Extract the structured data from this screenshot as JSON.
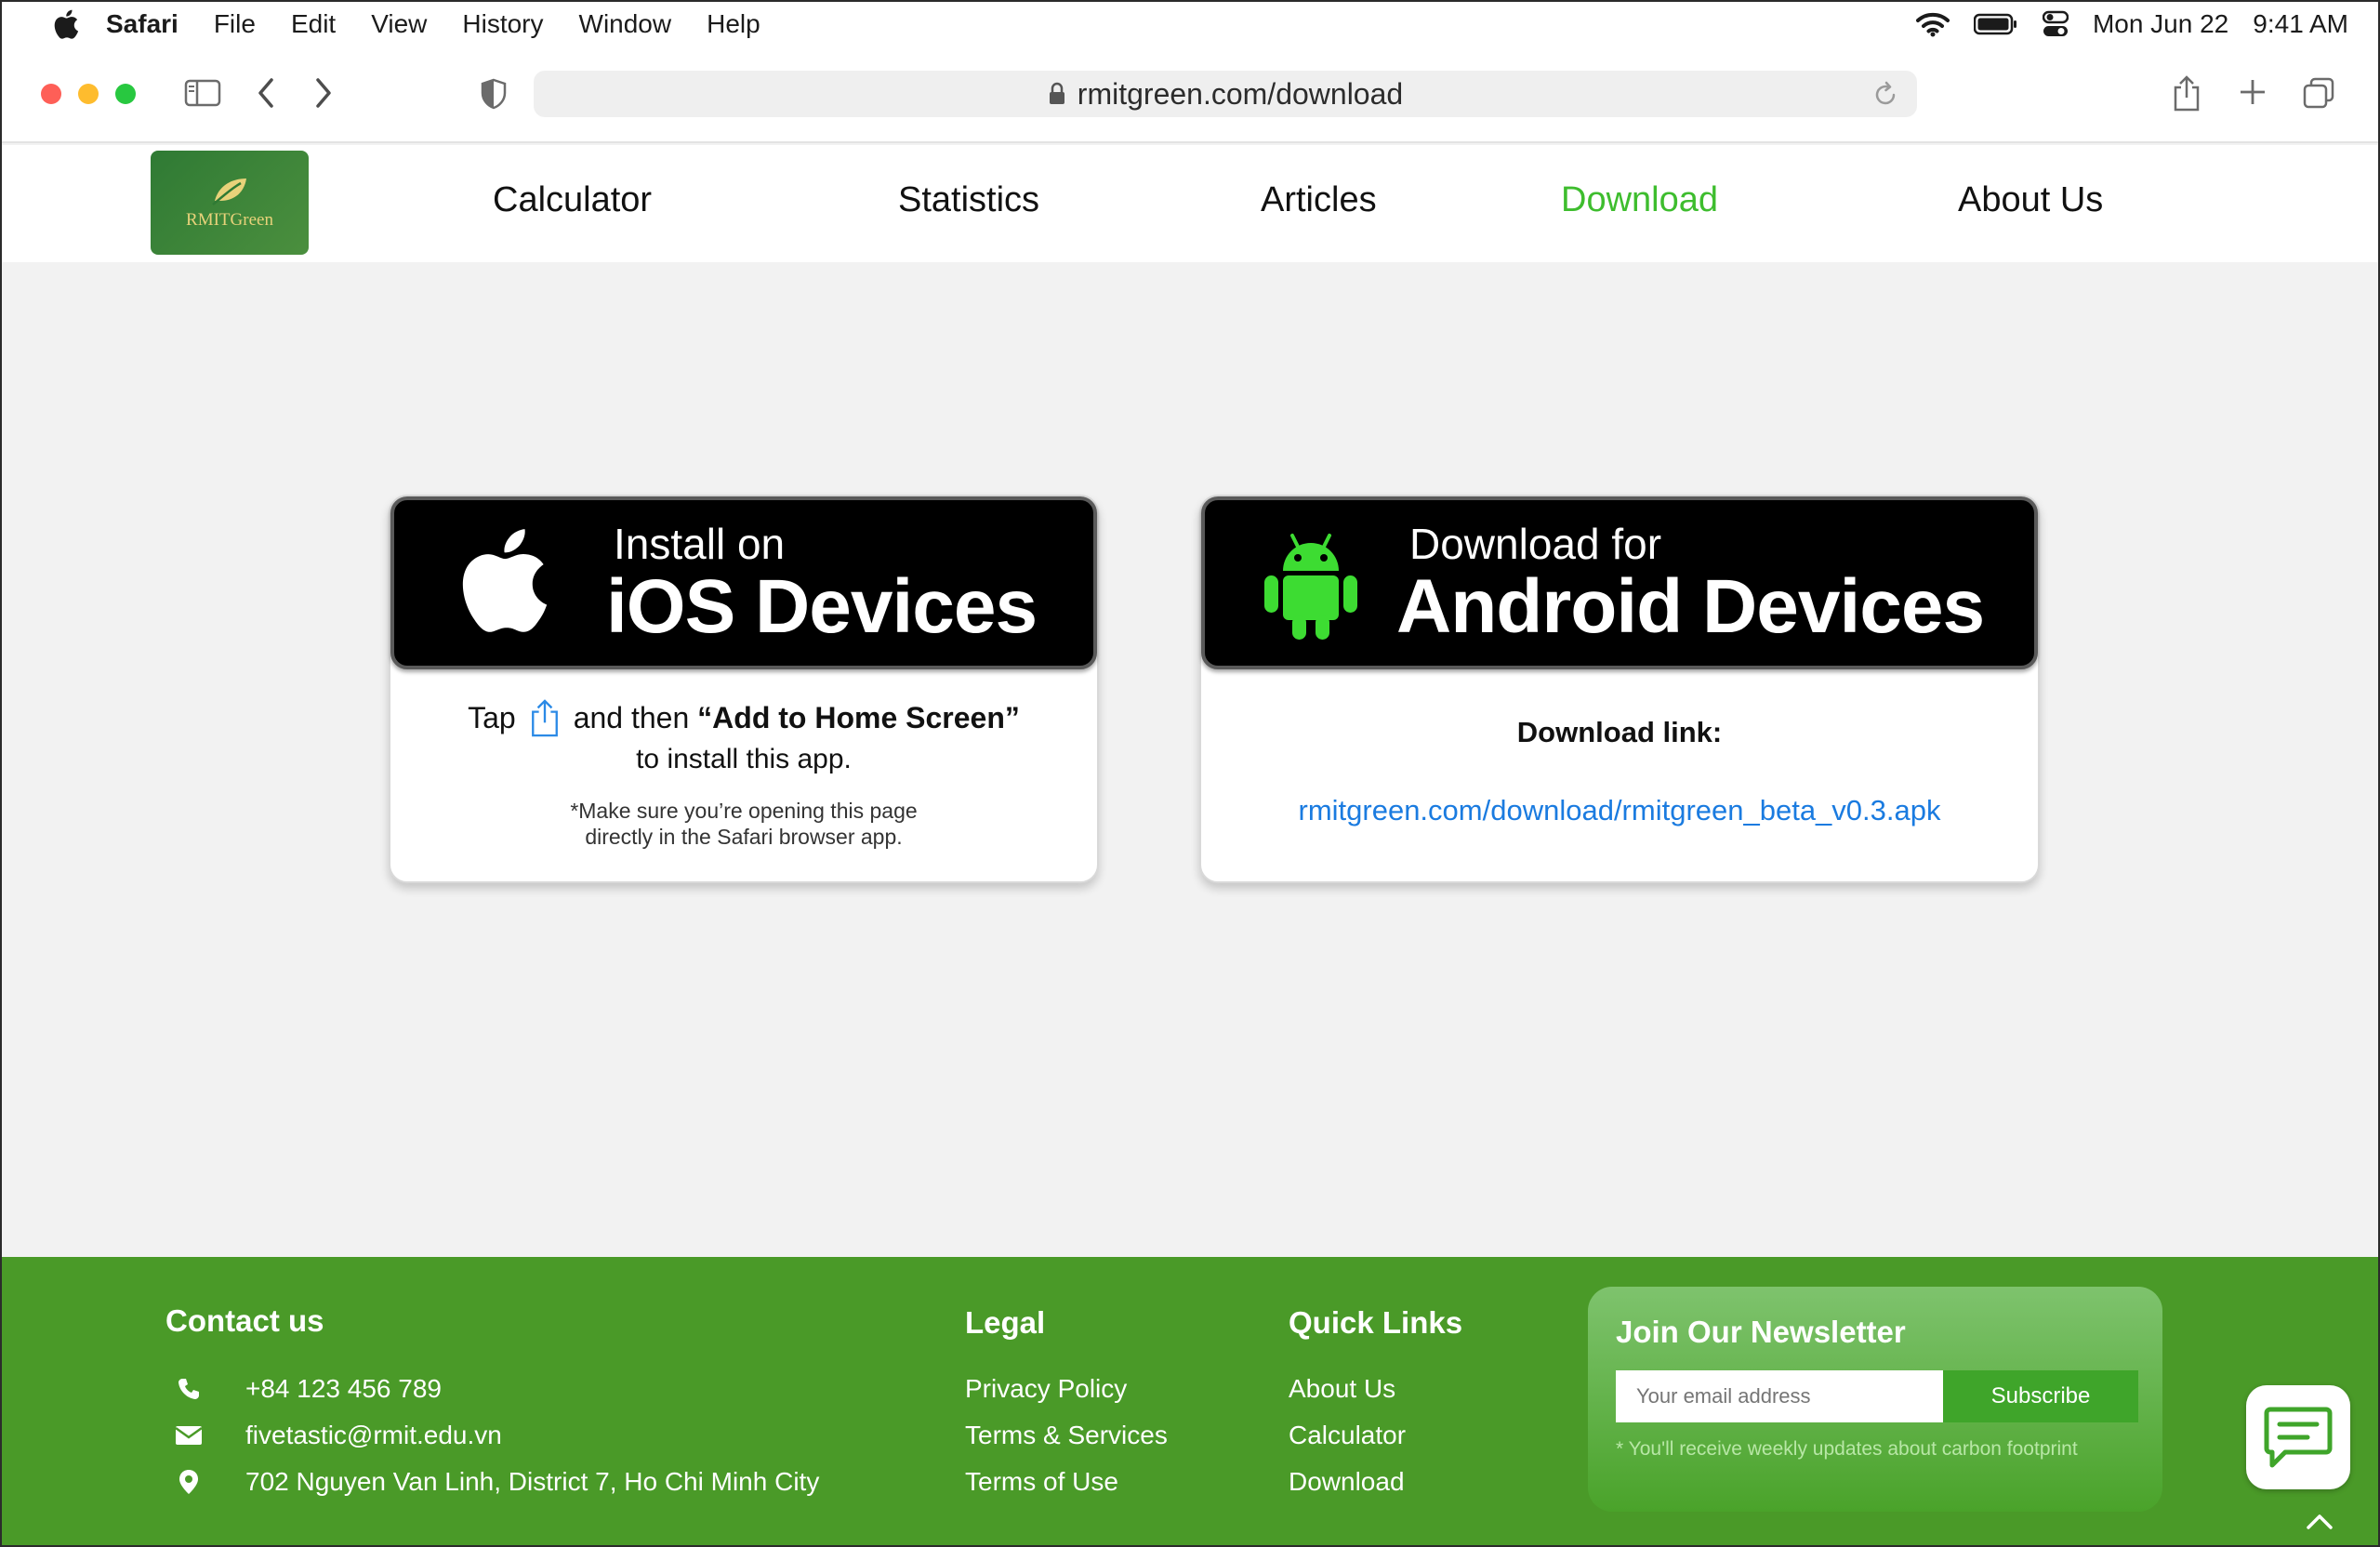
{
  "menubar": {
    "app_name": "Safari",
    "items": [
      "File",
      "Edit",
      "View",
      "History",
      "Window",
      "Help"
    ],
    "date": "Mon Jun 22",
    "time": "9:41 AM"
  },
  "browser": {
    "url": "rmitgreen.com/download"
  },
  "site": {
    "logo_text": "RMITGreen",
    "nav": [
      "Calculator",
      "Statistics",
      "Articles",
      "Download",
      "About Us"
    ],
    "active_nav": "Download"
  },
  "ios_card": {
    "small": "Install on",
    "big": "iOS Devices",
    "tap": "Tap",
    "and_then": "and then",
    "add_home": "“Add to Home Screen”",
    "install": "to install this app.",
    "note_line1": "*Make sure you’re opening this page",
    "note_line2": "directly in the Safari browser app."
  },
  "android_card": {
    "small": "Download for",
    "big": "Android Devices",
    "label": "Download link:",
    "link": "rmitgreen.com/download/rmitgreen_beta_v0.3.apk"
  },
  "footer": {
    "contact": {
      "title": "Contact us",
      "phone": "+84 123 456 789",
      "email": "fivetastic@rmit.edu.vn",
      "address": "702 Nguyen Van Linh, District 7, Ho Chi Minh City"
    },
    "legal": {
      "title": "Legal",
      "links": [
        "Privacy Policy",
        "Terms & Services",
        "Terms of Use"
      ]
    },
    "quick_links": {
      "title": "Quick Links",
      "links": [
        "About Us",
        "Calculator",
        "Download"
      ]
    },
    "newsletter": {
      "title": "Join Our Newsletter",
      "placeholder": "Your email address",
      "button": "Subscribe",
      "note": "* You'll receive weekly updates about carbon footprint"
    }
  },
  "colors": {
    "accent_green": "#3ebd2e",
    "footer_green": "#4a9a28",
    "link_blue": "#1a7be0",
    "android_green": "#3ddc32"
  }
}
